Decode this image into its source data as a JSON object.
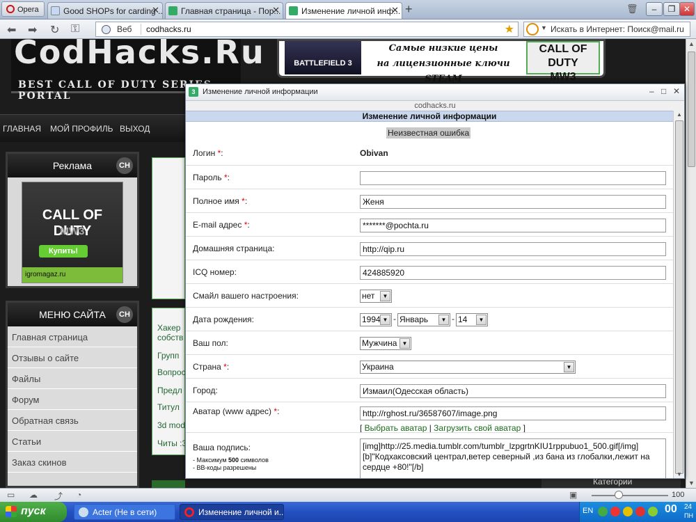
{
  "browser": {
    "menu_label": "Opera",
    "tabs": [
      {
        "label": "Good SHOPs for carding ..."
      },
      {
        "label": "Главная страница - Пор..."
      },
      {
        "label": "Изменение личной инф..."
      }
    ],
    "address": {
      "label": "Веб",
      "url": "codhacks.ru"
    },
    "search_placeholder": "Искать в Интернет: Поиск@mail.ru"
  },
  "site": {
    "logo_text": "CodHacks.Ru",
    "logo_tagline": "BEST CALL OF DUTY SERIES PORTAL",
    "banner": {
      "left": "BATTLEFIELD 3",
      "line1": "Самые низкие цены",
      "line2": "на лицензионные ключи STEAM",
      "right1": "CALL OF DUTY",
      "right2": "MW3"
    },
    "nav": [
      "ГЛАВНАЯ",
      "МОЙ ПРОФИЛЬ",
      "ВЫХОД"
    ],
    "ad_panel": {
      "title": "Реклама",
      "badge": "CH",
      "ad_title": "CALL OF DUTY",
      "ad_sub": "MW3",
      "ad_button": "Купить!",
      "ad_site": "igromagaz.ru"
    },
    "menu_panel": {
      "title": "МЕНЮ САЙТА",
      "badge": "CH",
      "items": [
        "Главная страница",
        "Отзывы о сайте",
        "Файлы",
        "Форум",
        "Обратная связь",
        "Статьи",
        "Заказ скинов"
      ]
    },
    "center_labels": [
      "Хакер",
      "собств",
      "Групп",
      "Вопрос",
      "Предл",
      "Титул",
      "3d mod",
      "Читы :3"
    ],
    "right_footer": "Категории"
  },
  "popup": {
    "window_title": "Изменение личной информации",
    "site": "codhacks.ru",
    "header": "Изменение личной информации",
    "error": "Неизвестная ошибка",
    "fields": {
      "login_label": "Логин",
      "login_value": "Obivan",
      "password_label": "Пароль",
      "password_value": "",
      "fullname_label": "Полное имя",
      "fullname_value": "Женя",
      "email_label": "E-mail адрес",
      "email_value": "*******@pochta.ru",
      "homepage_label": "Домашняя страница:",
      "homepage_value": "http://qip.ru",
      "icq_label": "ICQ номер:",
      "icq_value": "424885920",
      "mood_label": "Смайл вашего настроения:",
      "mood_value": "нет",
      "birth_label": "Дата рождения:",
      "birth_year": "1994",
      "birth_month": "Январь",
      "birth_day": "14",
      "gender_label": "Ваш пол:",
      "gender_value": "Мужчина",
      "country_label": "Страна",
      "country_value": "Украина",
      "city_label": "Город:",
      "city_value": "Измаил(Одесская область)",
      "avatar_label": "Аватар (www адрес)",
      "avatar_value": "http://rghost.ru/36587607/image.png",
      "avatar_choose": "Выбрать аватар",
      "avatar_upload": "Загрузить свой аватар",
      "signature_label": "Ваша подпись:",
      "signature_note1_pre": "- Максимум ",
      "signature_note1_num": "500",
      "signature_note1_post": " символов",
      "signature_note2": "- BB-коды разрешены",
      "signature_value": "[img]http://25.media.tumblr.com/tumblr_lzpgrtnKIU1rppubuo1_500.gif[/img] [b]\"Кодхаксовский централ,ветер северный ,из бана из глобалки,лежит на сердце +80!\"[/b]"
    }
  },
  "statusbar": {
    "zoom": "100"
  },
  "taskbar": {
    "start": "пуск",
    "tasks": [
      "Acter (Не в сети)",
      "Изменение личной и..."
    ],
    "lang": "EN",
    "time": "00",
    "time_small": "24",
    "day": "ПН"
  }
}
